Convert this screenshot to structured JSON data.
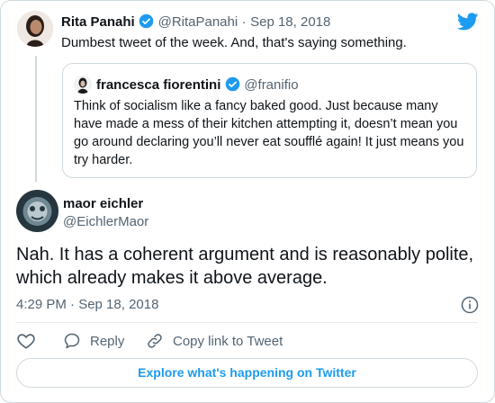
{
  "parent_tweet": {
    "author_name": "Rita Panahi",
    "author_handle": "@RitaPanahi",
    "separator": "·",
    "date": "Sep 18, 2018",
    "text": "Dumbest tweet of the week. And, that's saying something."
  },
  "quoted_tweet": {
    "author_name": "francesca fiorentini",
    "author_handle": "@franifio",
    "text": "Think of socialism like a fancy baked good. Just because many have made a mess of their kitchen attempting it, doesn’t mean you go around declaring you’ll never eat soufflé again! It just means you try harder."
  },
  "reply_tweet": {
    "author_name": "maor eichler",
    "author_handle": "@EichlerMaor",
    "text": "Nah. It has a coherent argument and is reasonably polite, which already makes it above average.",
    "timestamp": "4:29 PM · Sep 18, 2018"
  },
  "actions": {
    "reply_label": "Reply",
    "copy_link_label": "Copy link to Tweet"
  },
  "explore_label": "Explore what's happening on Twitter",
  "icons": {
    "brand": "twitter-bird-icon",
    "verified": "verified-badge-icon",
    "info": "info-icon",
    "like": "heart-icon",
    "reply": "speech-bubble-icon",
    "copy_link": "link-icon"
  },
  "colors": {
    "accent": "#1d9bf0",
    "text": "#0f1419",
    "secondary": "#536471",
    "border": "#cfd9de"
  }
}
